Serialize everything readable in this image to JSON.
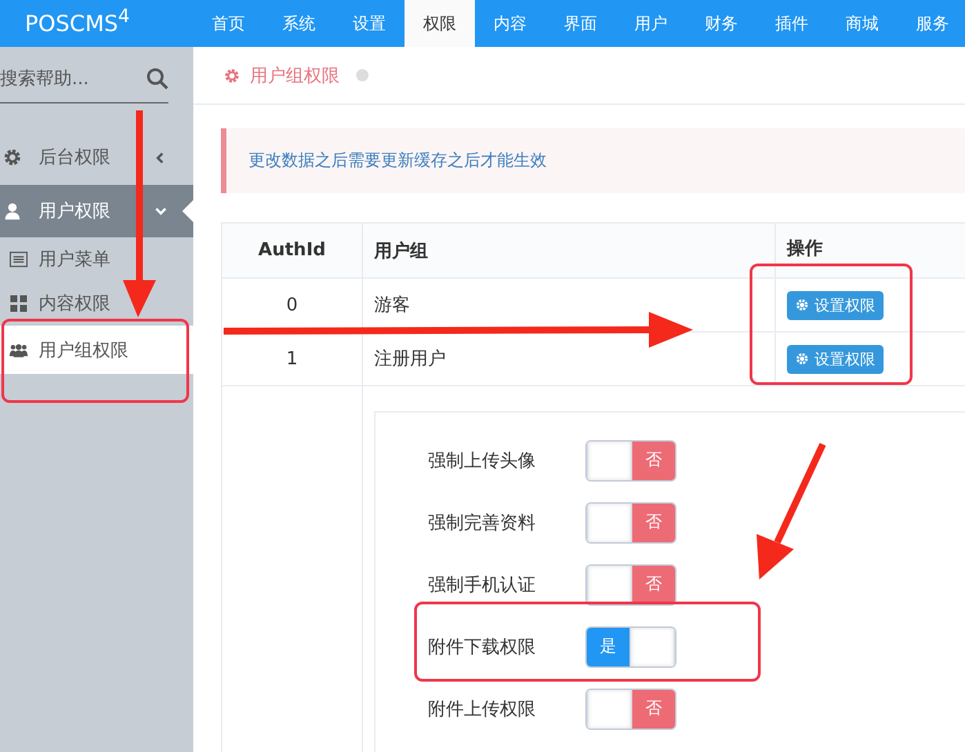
{
  "logo": "POSCMS$^{4}$",
  "nav": [
    {
      "label": "首页",
      "selected": false
    },
    {
      "label": "系统",
      "selected": false
    },
    {
      "label": "设置",
      "selected": false
    },
    {
      "label": "权限",
      "selected": true
    },
    {
      "label": "内容",
      "selected": false
    },
    {
      "label": "界面",
      "selected": false
    },
    {
      "label": "用户",
      "selected": false
    },
    {
      "label": "财务",
      "selected": false
    },
    {
      "label": "插件",
      "selected": false
    },
    {
      "label": "商城",
      "selected": false
    },
    {
      "label": "服务",
      "selected": false
    }
  ],
  "sidebar": {
    "search": {
      "placeholder": "搜索帮助..."
    },
    "items": [
      {
        "label": "后台权限",
        "expanded": false,
        "selected": false
      },
      {
        "label": "用户权限",
        "expanded": true,
        "selected": true,
        "children": [
          {
            "label": "用户菜单",
            "selected": false
          },
          {
            "label": "内容权限",
            "selected": false
          },
          {
            "label": "用户组权限",
            "selected": true
          }
        ]
      }
    ]
  },
  "breadcrumb": "用户组权限",
  "alert": "更改数据之后需要更新缓存之后才能生效",
  "table": {
    "columns": [
      "AuthId",
      "用户组",
      "操作"
    ],
    "rows": [
      {
        "id": "0",
        "group": "游客",
        "action": "设置权限"
      },
      {
        "id": "1",
        "group": "注册用户",
        "action": "设置权限"
      }
    ]
  },
  "settings": [
    {
      "label": "强制上传头像",
      "on": false,
      "text": "否"
    },
    {
      "label": "强制完善资料",
      "on": false,
      "text": "否"
    },
    {
      "label": "强制手机认证",
      "on": false,
      "text": "否"
    },
    {
      "label": "附件下载权限",
      "on": true,
      "text": "是"
    },
    {
      "label": "附件上传权限",
      "on": false,
      "text": "否"
    }
  ]
}
